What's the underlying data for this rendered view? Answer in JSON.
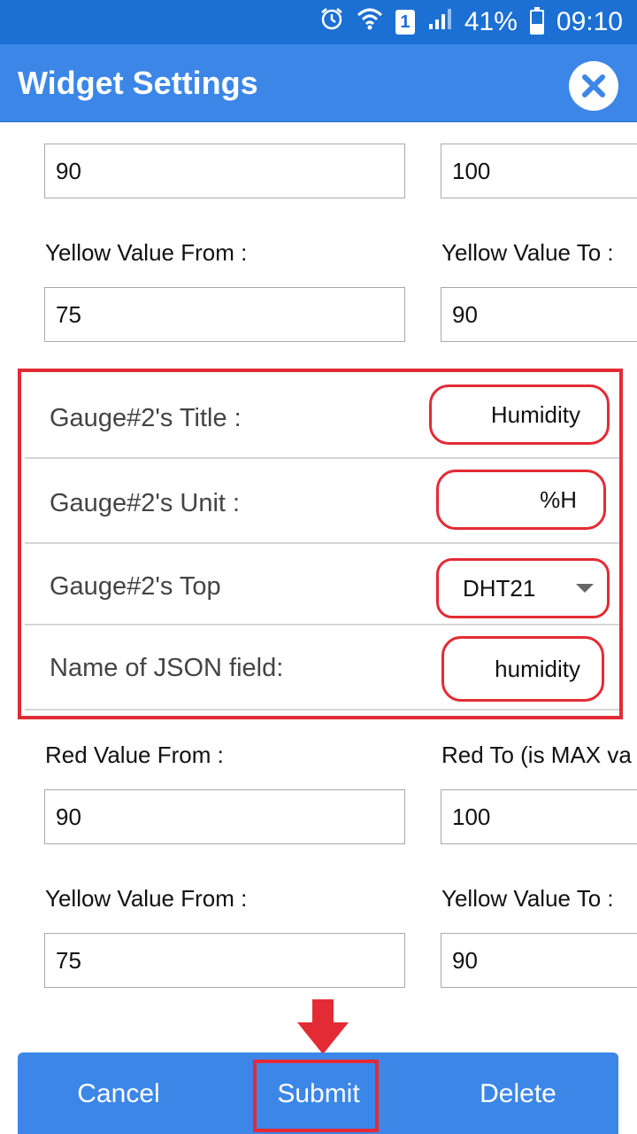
{
  "status_bar": {
    "battery": "41%",
    "time": "09:10",
    "sim_slot": "1",
    "battery_level_fraction": 0.41,
    "icons": [
      "alarm-icon",
      "wifi-icon",
      "sim-icon",
      "signal-icon",
      "battery-icon"
    ]
  },
  "header": {
    "title": "Widget Settings",
    "close_icon": "close-icon"
  },
  "form_top": {
    "red_from_value": "90",
    "red_to_value": "100",
    "yellow_from_label": "Yellow Value From :",
    "yellow_to_label": "Yellow Value To :",
    "yellow_from_value": "75",
    "yellow_to_value": "90"
  },
  "gauge2": {
    "title_label": "Gauge#2's Title :",
    "title_value": "Humidity",
    "unit_label": "Gauge#2's Unit :",
    "unit_value": "%H",
    "topic_label": "Gauge#2's Top",
    "topic_value": "DHT21",
    "json_label": "Name of JSON field:",
    "json_value": "humidity"
  },
  "form_bottom": {
    "red_from_label": "Red Value From :",
    "red_to_label": "Red To (is MAX va",
    "red_from_value": "90",
    "red_to_value": "100",
    "yellow_from_label": "Yellow Value From :",
    "yellow_to_label": "Yellow Value To :",
    "yellow_from_value": "75",
    "yellow_to_value": "90"
  },
  "actions": {
    "cancel": "Cancel",
    "submit": "Submit",
    "delete": "Delete"
  },
  "colors": {
    "status_bar": "#1c6fd3",
    "primary": "#3c86e8",
    "highlight": "#e32b35"
  }
}
